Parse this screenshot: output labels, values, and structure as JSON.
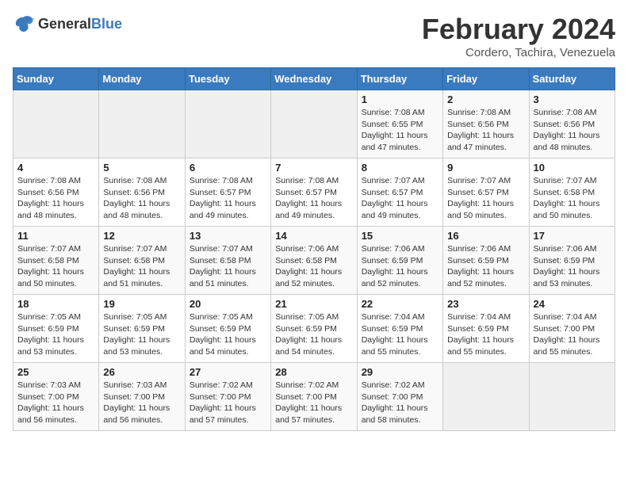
{
  "logo": {
    "general": "General",
    "blue": "Blue"
  },
  "calendar": {
    "title": "February 2024",
    "subtitle": "Cordero, Tachira, Venezuela"
  },
  "weekdays": [
    "Sunday",
    "Monday",
    "Tuesday",
    "Wednesday",
    "Thursday",
    "Friday",
    "Saturday"
  ],
  "weeks": [
    [
      {
        "day": "",
        "info": ""
      },
      {
        "day": "",
        "info": ""
      },
      {
        "day": "",
        "info": ""
      },
      {
        "day": "",
        "info": ""
      },
      {
        "day": "1",
        "info": "Sunrise: 7:08 AM\nSunset: 6:55 PM\nDaylight: 11 hours\nand 47 minutes."
      },
      {
        "day": "2",
        "info": "Sunrise: 7:08 AM\nSunset: 6:56 PM\nDaylight: 11 hours\nand 47 minutes."
      },
      {
        "day": "3",
        "info": "Sunrise: 7:08 AM\nSunset: 6:56 PM\nDaylight: 11 hours\nand 48 minutes."
      }
    ],
    [
      {
        "day": "4",
        "info": "Sunrise: 7:08 AM\nSunset: 6:56 PM\nDaylight: 11 hours\nand 48 minutes."
      },
      {
        "day": "5",
        "info": "Sunrise: 7:08 AM\nSunset: 6:56 PM\nDaylight: 11 hours\nand 48 minutes."
      },
      {
        "day": "6",
        "info": "Sunrise: 7:08 AM\nSunset: 6:57 PM\nDaylight: 11 hours\nand 49 minutes."
      },
      {
        "day": "7",
        "info": "Sunrise: 7:08 AM\nSunset: 6:57 PM\nDaylight: 11 hours\nand 49 minutes."
      },
      {
        "day": "8",
        "info": "Sunrise: 7:07 AM\nSunset: 6:57 PM\nDaylight: 11 hours\nand 49 minutes."
      },
      {
        "day": "9",
        "info": "Sunrise: 7:07 AM\nSunset: 6:57 PM\nDaylight: 11 hours\nand 50 minutes."
      },
      {
        "day": "10",
        "info": "Sunrise: 7:07 AM\nSunset: 6:58 PM\nDaylight: 11 hours\nand 50 minutes."
      }
    ],
    [
      {
        "day": "11",
        "info": "Sunrise: 7:07 AM\nSunset: 6:58 PM\nDaylight: 11 hours\nand 50 minutes."
      },
      {
        "day": "12",
        "info": "Sunrise: 7:07 AM\nSunset: 6:58 PM\nDaylight: 11 hours\nand 51 minutes."
      },
      {
        "day": "13",
        "info": "Sunrise: 7:07 AM\nSunset: 6:58 PM\nDaylight: 11 hours\nand 51 minutes."
      },
      {
        "day": "14",
        "info": "Sunrise: 7:06 AM\nSunset: 6:58 PM\nDaylight: 11 hours\nand 52 minutes."
      },
      {
        "day": "15",
        "info": "Sunrise: 7:06 AM\nSunset: 6:59 PM\nDaylight: 11 hours\nand 52 minutes."
      },
      {
        "day": "16",
        "info": "Sunrise: 7:06 AM\nSunset: 6:59 PM\nDaylight: 11 hours\nand 52 minutes."
      },
      {
        "day": "17",
        "info": "Sunrise: 7:06 AM\nSunset: 6:59 PM\nDaylight: 11 hours\nand 53 minutes."
      }
    ],
    [
      {
        "day": "18",
        "info": "Sunrise: 7:05 AM\nSunset: 6:59 PM\nDaylight: 11 hours\nand 53 minutes."
      },
      {
        "day": "19",
        "info": "Sunrise: 7:05 AM\nSunset: 6:59 PM\nDaylight: 11 hours\nand 53 minutes."
      },
      {
        "day": "20",
        "info": "Sunrise: 7:05 AM\nSunset: 6:59 PM\nDaylight: 11 hours\nand 54 minutes."
      },
      {
        "day": "21",
        "info": "Sunrise: 7:05 AM\nSunset: 6:59 PM\nDaylight: 11 hours\nand 54 minutes."
      },
      {
        "day": "22",
        "info": "Sunrise: 7:04 AM\nSunset: 6:59 PM\nDaylight: 11 hours\nand 55 minutes."
      },
      {
        "day": "23",
        "info": "Sunrise: 7:04 AM\nSunset: 6:59 PM\nDaylight: 11 hours\nand 55 minutes."
      },
      {
        "day": "24",
        "info": "Sunrise: 7:04 AM\nSunset: 7:00 PM\nDaylight: 11 hours\nand 55 minutes."
      }
    ],
    [
      {
        "day": "25",
        "info": "Sunrise: 7:03 AM\nSunset: 7:00 PM\nDaylight: 11 hours\nand 56 minutes."
      },
      {
        "day": "26",
        "info": "Sunrise: 7:03 AM\nSunset: 7:00 PM\nDaylight: 11 hours\nand 56 minutes."
      },
      {
        "day": "27",
        "info": "Sunrise: 7:02 AM\nSunset: 7:00 PM\nDaylight: 11 hours\nand 57 minutes."
      },
      {
        "day": "28",
        "info": "Sunrise: 7:02 AM\nSunset: 7:00 PM\nDaylight: 11 hours\nand 57 minutes."
      },
      {
        "day": "29",
        "info": "Sunrise: 7:02 AM\nSunset: 7:00 PM\nDaylight: 11 hours\nand 58 minutes."
      },
      {
        "day": "",
        "info": ""
      },
      {
        "day": "",
        "info": ""
      }
    ]
  ]
}
